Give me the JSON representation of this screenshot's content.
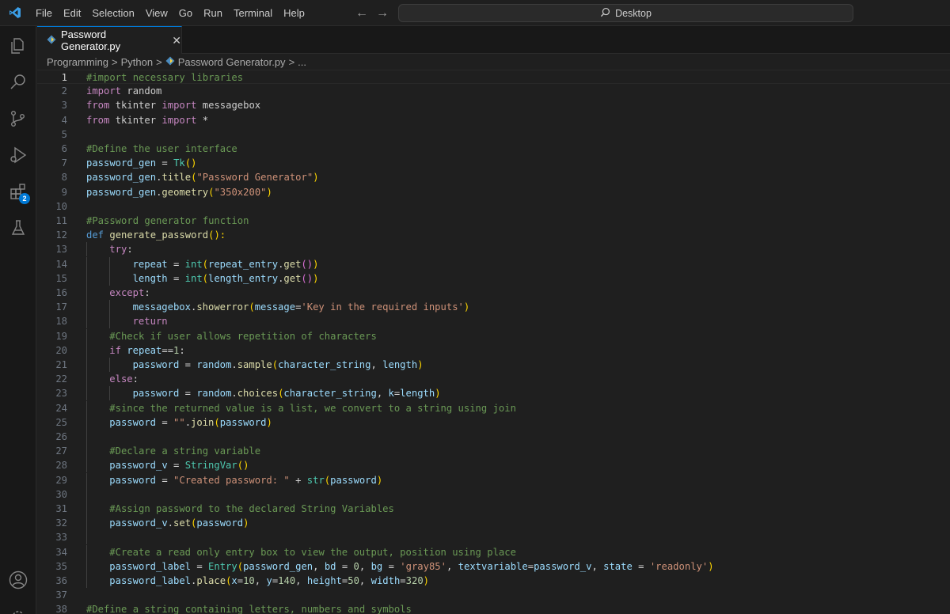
{
  "titlebar": {
    "menu": [
      "File",
      "Edit",
      "Selection",
      "View",
      "Go",
      "Run",
      "Terminal",
      "Help"
    ],
    "nav_back": "←",
    "nav_forward": "→",
    "search_text": "Desktop"
  },
  "activitybar": {
    "icons": [
      "explorer-icon",
      "search-icon",
      "source-control-icon",
      "run-debug-icon",
      "extensions-icon",
      "testing-icon",
      "account-icon",
      "settings-icon"
    ],
    "extensions_badge": "2"
  },
  "tab": {
    "label": "Password Generator.py",
    "close": "✕"
  },
  "breadcrumb": {
    "items": [
      "Programming",
      "Python",
      "Password Generator.py",
      "..."
    ],
    "separator": ">"
  },
  "colors": {
    "background": "#1f1f1f",
    "accent": "#0078d4",
    "comment": "#6a9955",
    "keyword": "#569cd6",
    "string": "#ce9178"
  },
  "editor": {
    "current_line": 1,
    "lines": [
      {
        "n": "1",
        "indent": 0,
        "tokens": [
          [
            "#import necessary libraries",
            "comment"
          ]
        ]
      },
      {
        "n": "2",
        "indent": 0,
        "tokens": [
          [
            "import",
            "control"
          ],
          [
            " random",
            "plain"
          ]
        ]
      },
      {
        "n": "3",
        "indent": 0,
        "tokens": [
          [
            "from",
            "control"
          ],
          [
            " tkinter ",
            "plain"
          ],
          [
            "import",
            "control"
          ],
          [
            " messagebox",
            "plain"
          ]
        ]
      },
      {
        "n": "4",
        "indent": 0,
        "tokens": [
          [
            "from",
            "control"
          ],
          [
            " tkinter ",
            "plain"
          ],
          [
            "import",
            "control"
          ],
          [
            " *",
            "op"
          ]
        ]
      },
      {
        "n": "5",
        "indent": 0,
        "tokens": []
      },
      {
        "n": "6",
        "indent": 0,
        "tokens": [
          [
            "#Define the user interface",
            "comment"
          ]
        ]
      },
      {
        "n": "7",
        "indent": 0,
        "tokens": [
          [
            "password_gen",
            "name"
          ],
          [
            " = ",
            "op"
          ],
          [
            "Tk",
            "class"
          ],
          [
            "()",
            "paren1"
          ]
        ]
      },
      {
        "n": "8",
        "indent": 0,
        "tokens": [
          [
            "password_gen",
            "name"
          ],
          [
            ".",
            "op"
          ],
          [
            "title",
            "func"
          ],
          [
            "(",
            "paren1"
          ],
          [
            "\"Password Generator\"",
            "string"
          ],
          [
            ")",
            "paren1"
          ]
        ]
      },
      {
        "n": "9",
        "indent": 0,
        "tokens": [
          [
            "password_gen",
            "name"
          ],
          [
            ".",
            "op"
          ],
          [
            "geometry",
            "func"
          ],
          [
            "(",
            "paren1"
          ],
          [
            "\"350x200\"",
            "string"
          ],
          [
            ")",
            "paren1"
          ]
        ]
      },
      {
        "n": "10",
        "indent": 0,
        "tokens": []
      },
      {
        "n": "11",
        "indent": 0,
        "tokens": [
          [
            "#Password generator function",
            "comment"
          ]
        ]
      },
      {
        "n": "12",
        "indent": 0,
        "tokens": [
          [
            "def",
            "keyword"
          ],
          [
            " ",
            "plain"
          ],
          [
            "generate_password",
            "func"
          ],
          [
            "():",
            "paren1"
          ]
        ]
      },
      {
        "n": "13",
        "indent": 1,
        "tokens": [
          [
            "try",
            "control"
          ],
          [
            ":",
            "op"
          ]
        ]
      },
      {
        "n": "14",
        "indent": 2,
        "tokens": [
          [
            "repeat",
            "name"
          ],
          [
            " = ",
            "op"
          ],
          [
            "int",
            "class"
          ],
          [
            "(",
            "paren1"
          ],
          [
            "repeat_entry",
            "name"
          ],
          [
            ".",
            "op"
          ],
          [
            "get",
            "func"
          ],
          [
            "()",
            "paren2"
          ],
          [
            ")",
            "paren1"
          ]
        ]
      },
      {
        "n": "15",
        "indent": 2,
        "tokens": [
          [
            "length",
            "name"
          ],
          [
            " = ",
            "op"
          ],
          [
            "int",
            "class"
          ],
          [
            "(",
            "paren1"
          ],
          [
            "length_entry",
            "name"
          ],
          [
            ".",
            "op"
          ],
          [
            "get",
            "func"
          ],
          [
            "()",
            "paren2"
          ],
          [
            ")",
            "paren1"
          ]
        ]
      },
      {
        "n": "16",
        "indent": 1,
        "tokens": [
          [
            "except",
            "control"
          ],
          [
            ":",
            "op"
          ]
        ]
      },
      {
        "n": "17",
        "indent": 2,
        "tokens": [
          [
            "messagebox",
            "name"
          ],
          [
            ".",
            "op"
          ],
          [
            "showerror",
            "func"
          ],
          [
            "(",
            "paren1"
          ],
          [
            "message",
            "name"
          ],
          [
            "=",
            "op"
          ],
          [
            "'Key in the required inputs'",
            "string"
          ],
          [
            ")",
            "paren1"
          ]
        ]
      },
      {
        "n": "18",
        "indent": 2,
        "tokens": [
          [
            "return",
            "control"
          ]
        ]
      },
      {
        "n": "19",
        "indent": 1,
        "tokens": [
          [
            "#Check if user allows repetition of characters",
            "comment"
          ]
        ]
      },
      {
        "n": "20",
        "indent": 1,
        "tokens": [
          [
            "if",
            "control"
          ],
          [
            " ",
            "plain"
          ],
          [
            "repeat",
            "name"
          ],
          [
            "==",
            "op"
          ],
          [
            "1",
            "number"
          ],
          [
            ":",
            "op"
          ]
        ]
      },
      {
        "n": "21",
        "indent": 2,
        "tokens": [
          [
            "password",
            "name"
          ],
          [
            " = ",
            "op"
          ],
          [
            "random",
            "name"
          ],
          [
            ".",
            "op"
          ],
          [
            "sample",
            "func"
          ],
          [
            "(",
            "paren1"
          ],
          [
            "character_string",
            "name"
          ],
          [
            ", ",
            "op"
          ],
          [
            "length",
            "name"
          ],
          [
            ")",
            "paren1"
          ]
        ]
      },
      {
        "n": "22",
        "indent": 1,
        "tokens": [
          [
            "else",
            "control"
          ],
          [
            ":",
            "op"
          ]
        ]
      },
      {
        "n": "23",
        "indent": 2,
        "tokens": [
          [
            "password",
            "name"
          ],
          [
            " = ",
            "op"
          ],
          [
            "random",
            "name"
          ],
          [
            ".",
            "op"
          ],
          [
            "choices",
            "func"
          ],
          [
            "(",
            "paren1"
          ],
          [
            "character_string",
            "name"
          ],
          [
            ", ",
            "op"
          ],
          [
            "k",
            "name"
          ],
          [
            "=",
            "op"
          ],
          [
            "length",
            "name"
          ],
          [
            ")",
            "paren1"
          ]
        ]
      },
      {
        "n": "24",
        "indent": 1,
        "tokens": [
          [
            "#since the returned value is a list, we convert to a string using join",
            "comment"
          ]
        ]
      },
      {
        "n": "25",
        "indent": 1,
        "tokens": [
          [
            "password",
            "name"
          ],
          [
            " = ",
            "op"
          ],
          [
            "\"\"",
            "string"
          ],
          [
            ".",
            "op"
          ],
          [
            "join",
            "func"
          ],
          [
            "(",
            "paren1"
          ],
          [
            "password",
            "name"
          ],
          [
            ")",
            "paren1"
          ]
        ]
      },
      {
        "n": "26",
        "indent": 1,
        "tokens": []
      },
      {
        "n": "27",
        "indent": 1,
        "tokens": [
          [
            "#Declare a string variable",
            "comment"
          ]
        ]
      },
      {
        "n": "28",
        "indent": 1,
        "tokens": [
          [
            "password_v",
            "name"
          ],
          [
            " = ",
            "op"
          ],
          [
            "StringVar",
            "class"
          ],
          [
            "()",
            "paren1"
          ]
        ]
      },
      {
        "n": "29",
        "indent": 1,
        "tokens": [
          [
            "password",
            "name"
          ],
          [
            " = ",
            "op"
          ],
          [
            "\"Created password: \"",
            "string"
          ],
          [
            " + ",
            "op"
          ],
          [
            "str",
            "class"
          ],
          [
            "(",
            "paren1"
          ],
          [
            "password",
            "name"
          ],
          [
            ")",
            "paren1"
          ]
        ]
      },
      {
        "n": "30",
        "indent": 1,
        "tokens": []
      },
      {
        "n": "31",
        "indent": 1,
        "tokens": [
          [
            "#Assign password to the declared String Variables",
            "comment"
          ]
        ]
      },
      {
        "n": "32",
        "indent": 1,
        "tokens": [
          [
            "password_v",
            "name"
          ],
          [
            ".",
            "op"
          ],
          [
            "set",
            "func"
          ],
          [
            "(",
            "paren1"
          ],
          [
            "password",
            "name"
          ],
          [
            ")",
            "paren1"
          ]
        ]
      },
      {
        "n": "33",
        "indent": 1,
        "tokens": []
      },
      {
        "n": "34",
        "indent": 1,
        "tokens": [
          [
            "#Create a read only entry box to view the output, position using place",
            "comment"
          ]
        ]
      },
      {
        "n": "35",
        "indent": 1,
        "tokens": [
          [
            "password_label",
            "name"
          ],
          [
            " = ",
            "op"
          ],
          [
            "Entry",
            "class"
          ],
          [
            "(",
            "paren1"
          ],
          [
            "password_gen",
            "name"
          ],
          [
            ", ",
            "op"
          ],
          [
            "bd",
            "name"
          ],
          [
            " = ",
            "op"
          ],
          [
            "0",
            "number"
          ],
          [
            ", ",
            "op"
          ],
          [
            "bg",
            "name"
          ],
          [
            " = ",
            "op"
          ],
          [
            "'gray85'",
            "string"
          ],
          [
            ", ",
            "op"
          ],
          [
            "textvariable",
            "name"
          ],
          [
            "=",
            "op"
          ],
          [
            "password_v",
            "name"
          ],
          [
            ", ",
            "op"
          ],
          [
            "state",
            "name"
          ],
          [
            " = ",
            "op"
          ],
          [
            "'readonly'",
            "string"
          ],
          [
            ")",
            "paren1"
          ]
        ]
      },
      {
        "n": "36",
        "indent": 1,
        "tokens": [
          [
            "password_label",
            "name"
          ],
          [
            ".",
            "op"
          ],
          [
            "place",
            "func"
          ],
          [
            "(",
            "paren1"
          ],
          [
            "x",
            "name"
          ],
          [
            "=",
            "op"
          ],
          [
            "10",
            "number"
          ],
          [
            ", ",
            "op"
          ],
          [
            "y",
            "name"
          ],
          [
            "=",
            "op"
          ],
          [
            "140",
            "number"
          ],
          [
            ", ",
            "op"
          ],
          [
            "height",
            "name"
          ],
          [
            "=",
            "op"
          ],
          [
            "50",
            "number"
          ],
          [
            ", ",
            "op"
          ],
          [
            "width",
            "name"
          ],
          [
            "=",
            "op"
          ],
          [
            "320",
            "number"
          ],
          [
            ")",
            "paren1"
          ]
        ]
      },
      {
        "n": "37",
        "indent": 0,
        "tokens": []
      },
      {
        "n": "38",
        "indent": 0,
        "tokens": [
          [
            "#Define a string containing letters, numbers and symbols",
            "comment"
          ]
        ]
      }
    ]
  }
}
